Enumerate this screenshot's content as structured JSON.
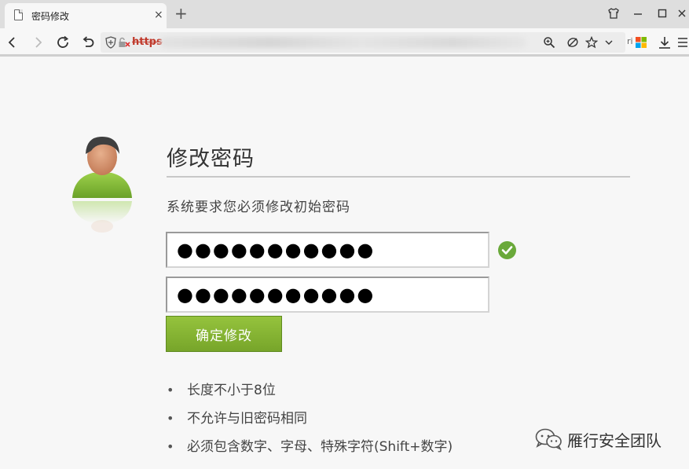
{
  "browser": {
    "tab": {
      "title": "密码修改",
      "close": "×"
    },
    "new_tab": "+",
    "address": {
      "scheme": "https",
      "tail": "ri"
    }
  },
  "page": {
    "title": "修改密码",
    "subtitle": "系统要求您必须修改初始密码",
    "new_password": {
      "value": "●●●●●●●●●●●"
    },
    "confirm_password": {
      "value": "●●●●●●●●●●●"
    },
    "submit_label": "确定修改",
    "rules": [
      "长度不小于8位",
      "不允许与旧密码相同",
      "必须包含数字、字母、特殊字符(Shift+数字)"
    ]
  },
  "watermark": {
    "text": "雁行安全团队"
  },
  "colors": {
    "accent_green": "#86b534",
    "check_green": "#6aa93a",
    "url_warning_red": "#c0392b"
  },
  "icons": {
    "tab": "page-icon",
    "toolbar": [
      "back-icon",
      "forward-icon",
      "reload-icon",
      "undo-icon",
      "shield-icon",
      "broken-lock-icon",
      "zoom-icon",
      "read-mode-icon",
      "star-icon",
      "chevron-down-icon",
      "apps-icon",
      "download-icon",
      "menu-icon"
    ],
    "window": [
      "skin-icon",
      "minimize-icon",
      "maximize-icon",
      "close-icon"
    ]
  }
}
